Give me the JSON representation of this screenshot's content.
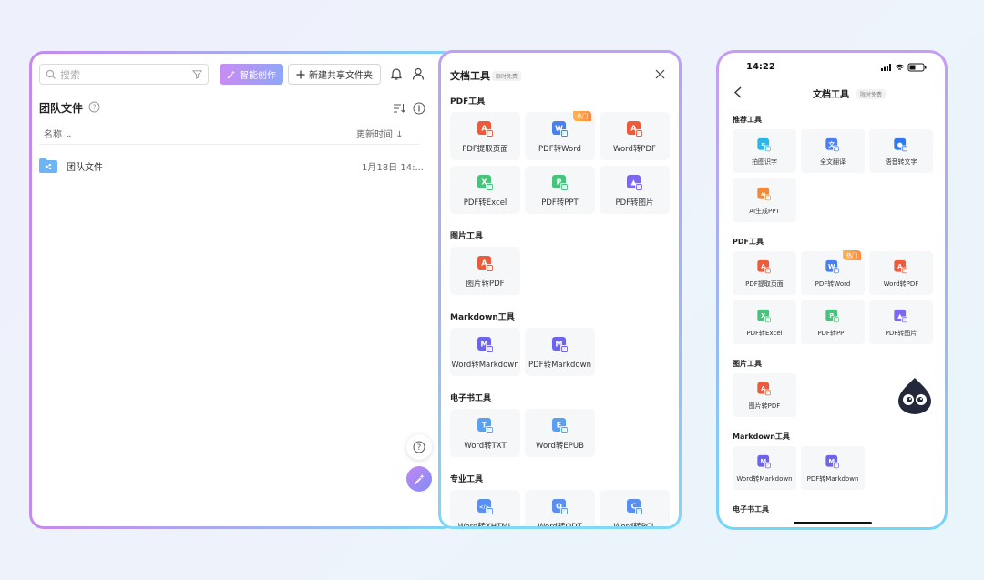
{
  "left": {
    "search_placeholder": "搜索",
    "ai_button": "智能创作",
    "new_folder_button": "新建共享文件夹",
    "page_title": "团队文件",
    "col_name": "名称",
    "col_time": "更新时间",
    "rows": [
      {
        "name": "团队文件",
        "time": "1月18日 14:..."
      }
    ]
  },
  "panel": {
    "title": "文档工具",
    "badge": "限时免费",
    "hot_label": "热门",
    "sections": [
      {
        "title": "PDF工具",
        "tools": [
          {
            "label": "PDF提取页面",
            "icon": "pdf-icon",
            "color": "#ee5b3a"
          },
          {
            "label": "PDF转Word",
            "icon": "word-icon",
            "color": "#4a7ff0",
            "hot": true
          },
          {
            "label": "Word转PDF",
            "icon": "pdf-icon",
            "color": "#ee5b3a"
          },
          {
            "label": "PDF转Excel",
            "icon": "xls-icon",
            "color": "#47c37b"
          },
          {
            "label": "PDF转PPT",
            "icon": "ppt-icon",
            "color": "#47c37b"
          },
          {
            "label": "PDF转图片",
            "icon": "image-icon",
            "color": "#7a68ef"
          }
        ]
      },
      {
        "title": "图片工具",
        "tools": [
          {
            "label": "图片转PDF",
            "icon": "pdf-icon",
            "color": "#ee5b3a"
          }
        ]
      },
      {
        "title": "Markdown工具",
        "tools": [
          {
            "label": "Word转Markdown",
            "icon": "markdown-icon",
            "color": "#6d64ee"
          },
          {
            "label": "PDF转Markdown",
            "icon": "markdown-icon",
            "color": "#6d64ee"
          }
        ]
      },
      {
        "title": "电子书工具",
        "tools": [
          {
            "label": "Word转TXT",
            "icon": "txt-icon",
            "color": "#5aa0f0"
          },
          {
            "label": "Word转EPUB",
            "icon": "epub-icon",
            "color": "#5aa0f0"
          }
        ]
      },
      {
        "title": "专业工具",
        "tools": [
          {
            "label": "Word转XHTML",
            "icon": "code-icon",
            "color": "#5a8ef0"
          },
          {
            "label": "Word转ODT",
            "icon": "odt-icon",
            "color": "#5a8ef0"
          },
          {
            "label": "Word转PCL",
            "icon": "pcl-icon",
            "color": "#5a8ef0"
          }
        ]
      }
    ]
  },
  "phone": {
    "time": "14:22",
    "title": "文档工具",
    "badge": "限时免费",
    "hot_label": "热门",
    "sections": [
      {
        "title": "推荐工具",
        "tools": [
          {
            "label": "拍图识字",
            "icon": "scan-icon",
            "color": "#2bb6e8"
          },
          {
            "label": "全文翻译",
            "icon": "translate-icon",
            "color": "#4a7ff0"
          },
          {
            "label": "语音转文字",
            "icon": "mic-icon",
            "color": "#2f78f0"
          },
          {
            "label": "AI生成PPT",
            "icon": "ai-ppt-icon",
            "color": "#f08a3a"
          }
        ]
      },
      {
        "title": "PDF工具",
        "tools": [
          {
            "label": "PDF提取页面",
            "icon": "pdf-icon",
            "color": "#ee5b3a"
          },
          {
            "label": "PDF转Word",
            "icon": "word-icon",
            "color": "#4a7ff0",
            "hot": true
          },
          {
            "label": "Word转PDF",
            "icon": "pdf-icon",
            "color": "#ee5b3a"
          },
          {
            "label": "PDF转Excel",
            "icon": "xls-icon",
            "color": "#47c37b"
          },
          {
            "label": "PDF转PPT",
            "icon": "ppt-icon",
            "color": "#47c37b"
          },
          {
            "label": "PDF转图片",
            "icon": "image-icon",
            "color": "#7a68ef"
          }
        ]
      },
      {
        "title": "图片工具",
        "tools": [
          {
            "label": "图片转PDF",
            "icon": "pdf-icon",
            "color": "#ee5b3a"
          }
        ]
      },
      {
        "title": "Markdown工具",
        "tools": [
          {
            "label": "Word转Markdown",
            "icon": "markdown-icon",
            "color": "#6d64ee"
          },
          {
            "label": "PDF转Markdown",
            "icon": "markdown-icon",
            "color": "#6d64ee"
          }
        ]
      },
      {
        "title": "电子书工具",
        "tools": []
      }
    ]
  }
}
